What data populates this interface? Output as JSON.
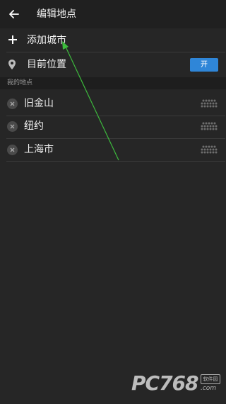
{
  "header": {
    "title": "编辑地点",
    "back_icon": "arrow-left-icon"
  },
  "add_city": {
    "label": "添加城市",
    "icon": "plus-icon"
  },
  "current_location": {
    "label": "目前位置",
    "icon": "location-pin-icon",
    "toggle_label": "开",
    "toggle_on": true,
    "toggle_color": "#2f86d8"
  },
  "my_places": {
    "header": "我的地点",
    "cities": [
      {
        "name": "旧金山"
      },
      {
        "name": "纽约"
      },
      {
        "name": "上海市"
      }
    ]
  },
  "overlay": {
    "arrow_color": "#3dbb3d"
  },
  "watermark": {
    "logo": "PC768",
    "badge": "软件园",
    "domain": ".com"
  },
  "colors": {
    "background": "#262626",
    "topbar": "#202020",
    "section_header": "#1e1e1e",
    "accent": "#2f86d8"
  }
}
